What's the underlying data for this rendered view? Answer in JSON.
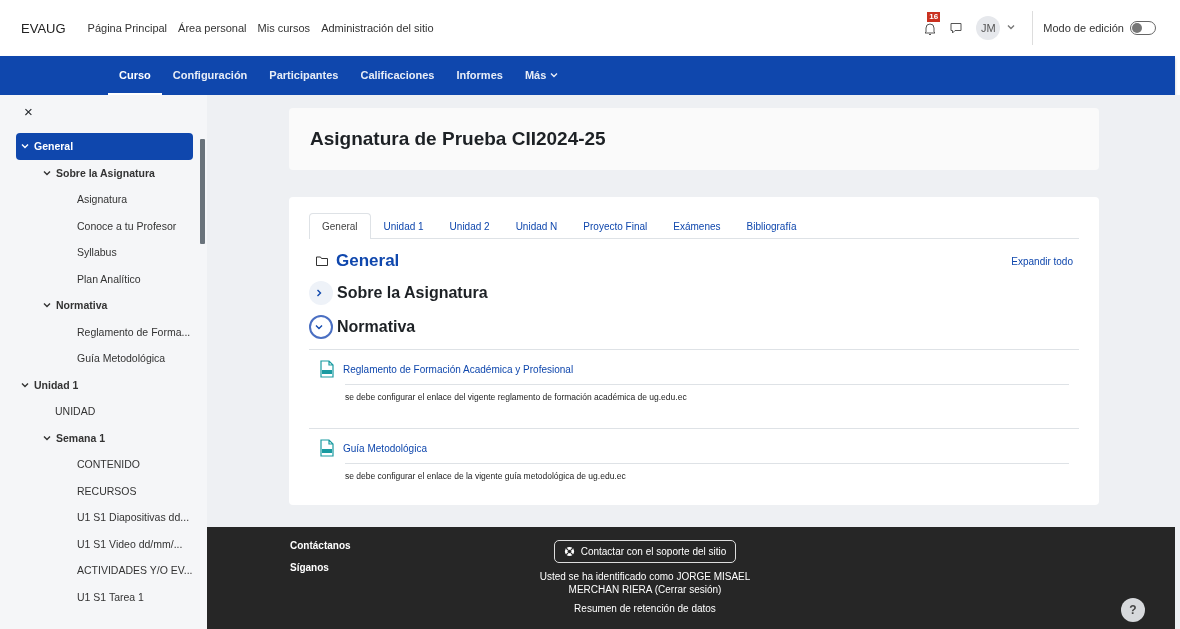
{
  "topbar": {
    "brand": "EVAUG",
    "links": [
      "Página Principal",
      "Área personal",
      "Mis cursos",
      "Administración del sitio"
    ],
    "notification_count": "16",
    "avatar_initials": "JM",
    "edit_mode": {
      "label": "Modo de edición",
      "on": false
    }
  },
  "course_nav": [
    {
      "label": "Curso",
      "selected": true
    },
    {
      "label": "Configuración",
      "selected": false
    },
    {
      "label": "Participantes",
      "selected": false
    },
    {
      "label": "Calificaciones",
      "selected": false
    },
    {
      "label": "Informes",
      "selected": false
    },
    {
      "label": "Más",
      "selected": false,
      "dropdown": true
    }
  ],
  "sidebar": {
    "close": "×",
    "items": [
      {
        "label": "General",
        "expanded": true,
        "selected": true,
        "children": [
          {
            "label": "Sobre la Asignatura",
            "expanded": true,
            "selected": false,
            "children": [
              {
                "label": "Asignatura",
                "selected": false
              },
              {
                "label": "Conoce a tu Profesor",
                "selected": false
              },
              {
                "label": "Syllabus",
                "selected": false
              },
              {
                "label": "Plan Analítico",
                "selected": false
              }
            ]
          },
          {
            "label": "Normativa",
            "expanded": true,
            "selected": false,
            "children": [
              {
                "label": "Reglamento de Forma...",
                "selected": false
              },
              {
                "label": "Guía Metodológica",
                "selected": false
              }
            ]
          }
        ]
      },
      {
        "label": "Unidad 1",
        "expanded": true,
        "selected": false,
        "children": [
          {
            "label": "UNIDAD",
            "selected": false
          },
          {
            "label": "Semana 1",
            "expanded": true,
            "selected": false,
            "children": [
              {
                "label": "CONTENIDO",
                "selected": false
              },
              {
                "label": "RECURSOS",
                "selected": false
              },
              {
                "label": "U1 S1 Diapositivas dd...",
                "selected": false
              },
              {
                "label": "U1 S1 Video dd/mm/...",
                "selected": false
              },
              {
                "label": "ACTIVIDADES Y/O EV...",
                "selected": false
              },
              {
                "label": "U1 S1 Tarea 1",
                "selected": false
              }
            ]
          }
        ]
      }
    ]
  },
  "course": {
    "title": "Asignatura de Prueba CII2024-25",
    "tabs": [
      {
        "label": "General",
        "selected": true
      },
      {
        "label": "Unidad 1",
        "selected": false
      },
      {
        "label": "Unidad 2",
        "selected": false
      },
      {
        "label": "Unidad N",
        "selected": false
      },
      {
        "label": "Proyecto Final",
        "selected": false
      },
      {
        "label": "Exámenes",
        "selected": false
      },
      {
        "label": "Bibliografía",
        "selected": false
      }
    ],
    "section_title": "General",
    "expand_all": "Expandir todo",
    "sections": [
      {
        "title": "Sobre la Asignatura",
        "expanded": false
      },
      {
        "title": "Normativa",
        "expanded": true,
        "activities": [
          {
            "name": "Reglamento de Formación Académica y Profesional",
            "description": "se debe configurar el enlace del vigente reglamento de formación académica de ug.edu.ec"
          },
          {
            "name": "Guía Metodológica",
            "description": "se debe configurar el enlace de la vigente guía metodológica de ug.edu.ec"
          }
        ]
      }
    ]
  },
  "footer": {
    "links": [
      "Contáctanos",
      "Síganos"
    ],
    "support_button": "Contactar con el soporte del sitio",
    "login_text": "Usted se ha identificado como JORGE MISAEL MERCHAN RIERA",
    "logout_link": "(Cerrar sesión)",
    "retention_link": "Resumen de retención de datos",
    "help": "?"
  }
}
